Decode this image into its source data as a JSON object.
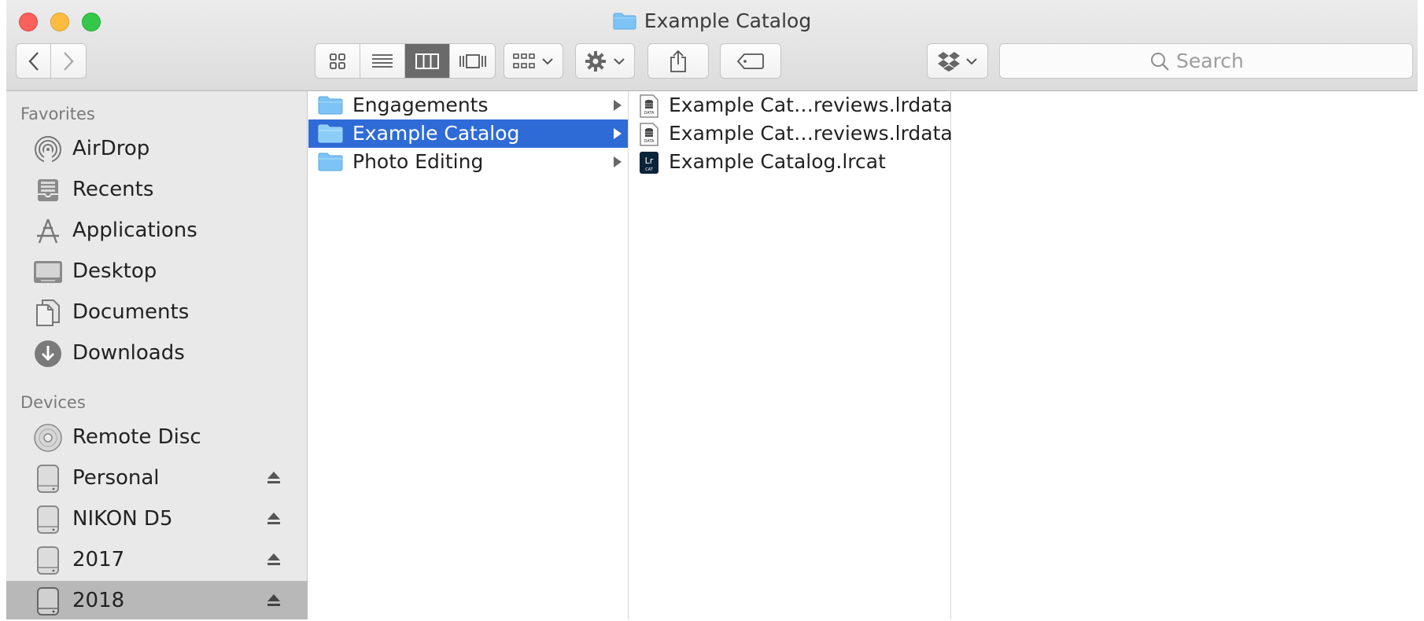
{
  "window": {
    "title": "Example Catalog"
  },
  "toolbar": {
    "view_modes": [
      "icon-view",
      "list-view",
      "column-view",
      "cover-flow-view"
    ],
    "active_view": "column-view",
    "search_placeholder": "Search"
  },
  "sidebar": {
    "favorites_header": "Favorites",
    "favorites": [
      {
        "label": "AirDrop",
        "icon": "airdrop-icon"
      },
      {
        "label": "Recents",
        "icon": "recents-icon"
      },
      {
        "label": "Applications",
        "icon": "applications-icon"
      },
      {
        "label": "Desktop",
        "icon": "desktop-icon"
      },
      {
        "label": "Documents",
        "icon": "documents-icon"
      },
      {
        "label": "Downloads",
        "icon": "downloads-icon"
      }
    ],
    "devices_header": "Devices",
    "devices": [
      {
        "label": "Remote Disc",
        "icon": "disc-icon",
        "eject": false
      },
      {
        "label": "Personal",
        "icon": "drive-icon",
        "eject": true
      },
      {
        "label": "NIKON D5",
        "icon": "drive-icon",
        "eject": true
      },
      {
        "label": "2017",
        "icon": "drive-icon",
        "eject": true
      },
      {
        "label": "2018",
        "icon": "drive-icon",
        "eject": true,
        "selected": true
      }
    ]
  },
  "column1": {
    "items": [
      {
        "label": "Engagements",
        "type": "folder"
      },
      {
        "label": "Example Catalog",
        "type": "folder",
        "selected": true
      },
      {
        "label": "Photo Editing",
        "type": "folder"
      }
    ]
  },
  "column2": {
    "items": [
      {
        "label": "Example Cat…reviews.lrdata",
        "type": "lrdata"
      },
      {
        "label": "Example Cat…reviews.lrdata",
        "type": "lrdata"
      },
      {
        "label": "Example Catalog.lrcat",
        "type": "lrcat"
      }
    ]
  },
  "colors": {
    "selection": "#2f6bd6",
    "sidebar_bg": "#e9e9e9",
    "folder": "#7dc3f5"
  }
}
